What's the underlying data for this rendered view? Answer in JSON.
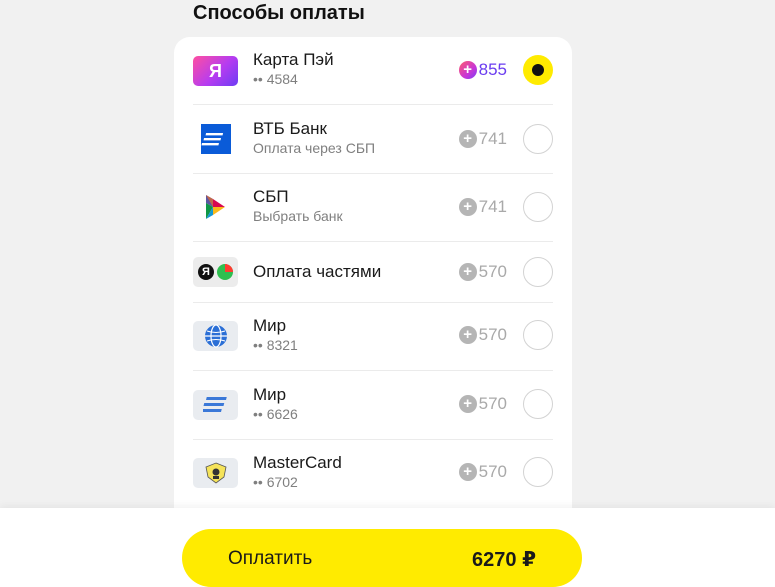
{
  "page": {
    "title": "Способы оплаты"
  },
  "methods": [
    {
      "name": "Карта Пэй",
      "sub": "•• 4584",
      "bonus": "855",
      "selected": true,
      "logo_icon": "yandex-pay-icon",
      "logo_glyph": "Я"
    },
    {
      "name": "ВТБ Банк",
      "sub": "Оплата через СБП",
      "bonus": "741",
      "selected": false,
      "logo_icon": "vtb-bank-icon"
    },
    {
      "name": "СБП",
      "sub": "Выбрать банк",
      "bonus": "741",
      "selected": false,
      "logo_icon": "sbp-icon"
    },
    {
      "name": "Оплата частями",
      "sub": "",
      "bonus": "570",
      "selected": false,
      "logo_icon": "split-payment-icon",
      "logo_glyph": "Я"
    },
    {
      "name": "Мир",
      "sub": "•• 8321",
      "bonus": "570",
      "selected": false,
      "logo_icon": "bank-card-globe-icon"
    },
    {
      "name": "Мир",
      "sub": "•• 6626",
      "bonus": "570",
      "selected": false,
      "logo_icon": "bank-card-stripes-icon"
    },
    {
      "name": "MasterCard",
      "sub": "•• 6702",
      "bonus": "570",
      "selected": false,
      "logo_icon": "tinkoff-card-icon"
    }
  ],
  "footer": {
    "pay_label": "Оплатить",
    "amount": "6270 ₽"
  },
  "colors": {
    "accent_yellow": "#ffeb00",
    "bonus_active": "#6a3cf0",
    "bonus_inactive": "#a9a9a9"
  }
}
